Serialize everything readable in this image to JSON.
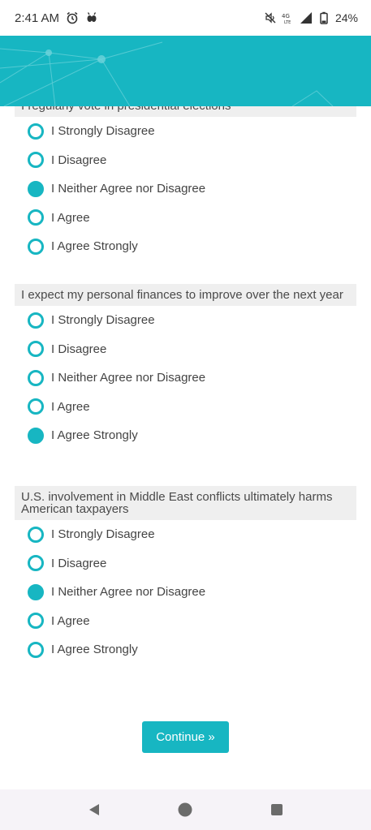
{
  "status_bar": {
    "time": "2:41 AM",
    "battery": "24%",
    "icons": [
      "alarm-icon",
      "bug-icon",
      "mute-icon",
      "lte-icon",
      "signal-icon",
      "battery-icon"
    ]
  },
  "colors": {
    "accent": "#17b6c2",
    "prompt_bg": "#efefef",
    "text": "#4a4a4a"
  },
  "questions": [
    {
      "prompt": "I regularly vote in presidential elections",
      "options": [
        "I Strongly Disagree",
        "I Disagree",
        "I Neither Agree nor Disagree",
        "I Agree",
        "I Agree Strongly"
      ],
      "selected": "I Neither Agree nor Disagree"
    },
    {
      "prompt": "I expect my personal finances to improve over the next year",
      "options": [
        "I Strongly Disagree",
        "I Disagree",
        "I Neither Agree nor Disagree",
        "I Agree",
        "I Agree Strongly"
      ],
      "selected": "I Agree Strongly"
    },
    {
      "prompt": "U.S. involvement in Middle East conflicts ultimately harms American taxpayers",
      "options": [
        "I Strongly Disagree",
        "I Disagree",
        "I Neither Agree nor Disagree",
        "I Agree",
        "I Agree Strongly"
      ],
      "selected": "I Neither Agree nor Disagree"
    }
  ],
  "continue_label": "Continue »",
  "nav_bar": {
    "icons": [
      "back-icon",
      "home-icon",
      "recents-icon"
    ]
  }
}
